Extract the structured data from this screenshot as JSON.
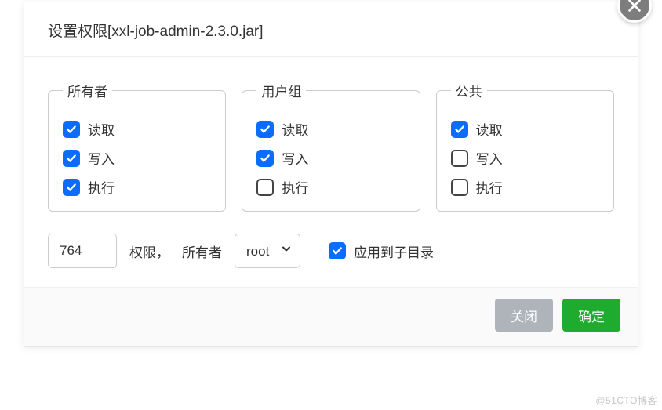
{
  "dialog": {
    "title": "设置权限[xxl-job-admin-2.3.0.jar]"
  },
  "groups": {
    "owner": {
      "legend": "所有者",
      "read": {
        "label": "读取",
        "checked": true
      },
      "write": {
        "label": "写入",
        "checked": true
      },
      "execute": {
        "label": "执行",
        "checked": true
      }
    },
    "group": {
      "legend": "用户组",
      "read": {
        "label": "读取",
        "checked": true
      },
      "write": {
        "label": "写入",
        "checked": true
      },
      "execute": {
        "label": "执行",
        "checked": false
      }
    },
    "public": {
      "legend": "公共",
      "read": {
        "label": "读取",
        "checked": true
      },
      "write": {
        "label": "写入",
        "checked": false
      },
      "execute": {
        "label": "执行",
        "checked": false
      }
    }
  },
  "numeric": {
    "value": "764",
    "label": "权限，"
  },
  "owner_select": {
    "label": "所有者",
    "value": "root"
  },
  "apply_subdir": {
    "label": "应用到子目录",
    "checked": true
  },
  "footer": {
    "close": "关闭",
    "confirm": "确定"
  },
  "watermark": "@51CTO博客"
}
